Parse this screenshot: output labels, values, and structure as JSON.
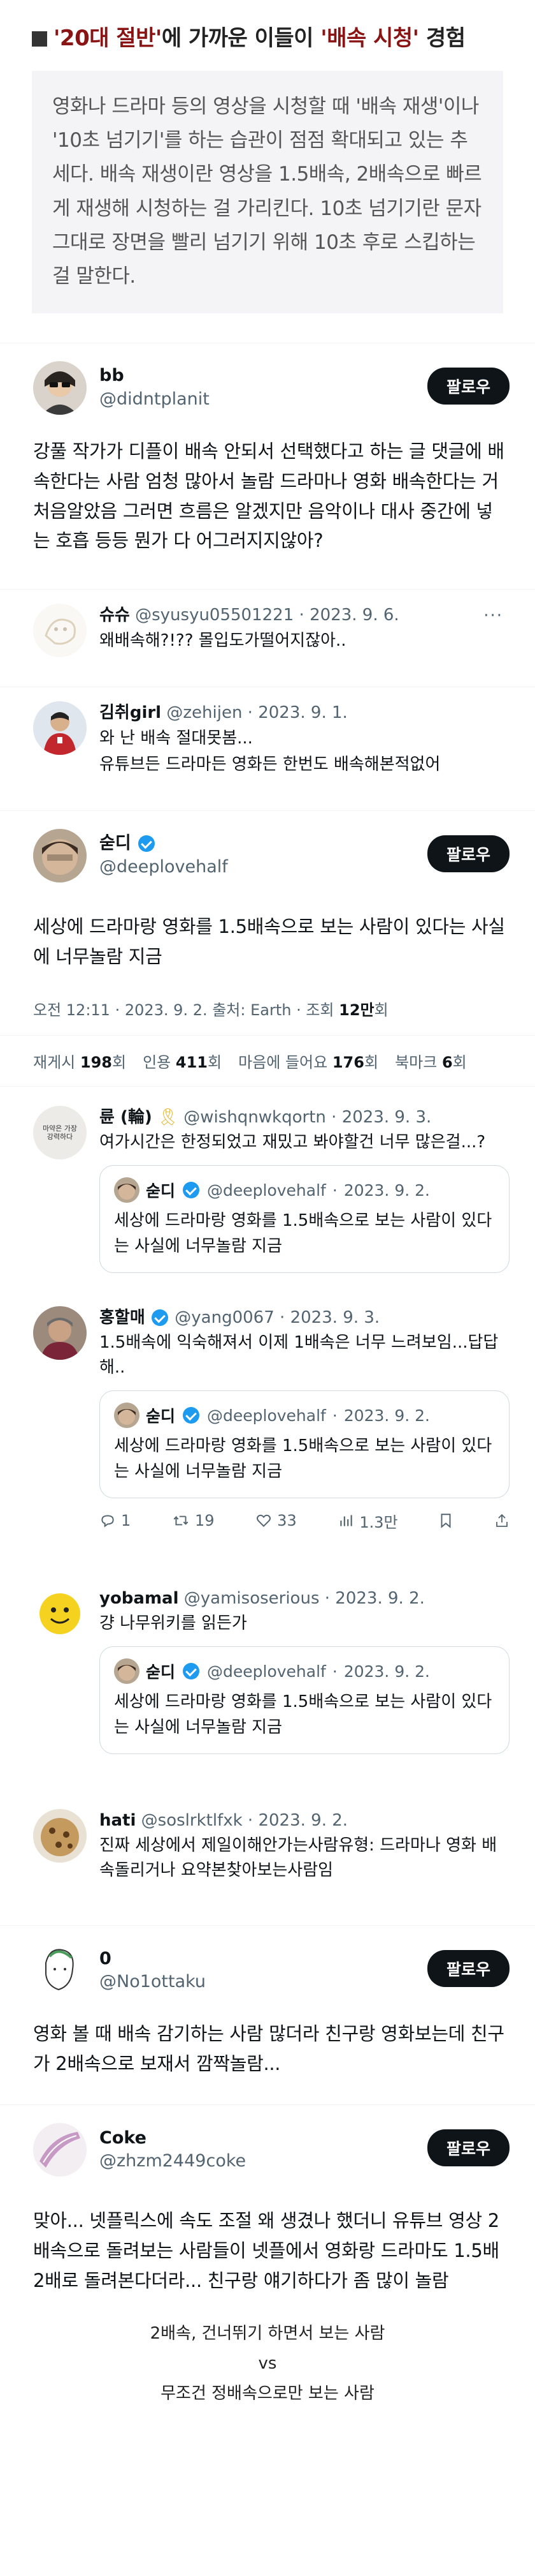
{
  "article": {
    "title_prefix": "■",
    "title_q1": "'20대 절반'",
    "title_mid": "에 가까운 이들이 ",
    "title_q2": "'배속 시청'",
    "title_end": " 경험",
    "body": "영화나 드라마 등의 영상을 시청할 때 '배속 재생'이나 '10초 넘기기'를 하는 습관이 점점 확대되고 있는 추세다. 배속 재생이란 영상을 1.5배속, 2배속으로 빠르게 재생해 시청하는 걸 가리킨다. 10초 넘기기란 문자 그대로 장면을 빨리 넘기기 위해 10초 후로 스킵하는 걸 말한다."
  },
  "follow_label": "팔로우",
  "more_label": "···",
  "tweet1": {
    "name": "bb",
    "handle": "@didntplanit",
    "text": "강풀 작가가 디플이 배속 안되서 선택했다고 하는 글 댓글에 배속한다는 사람 엄청 많아서 놀람 드라마나 영화 배속한다는 거 처음알았음 그러면 흐름은 알겠지만 음악이나 대사 중간에 넣는 호흡 등등 뭔가 다 어그러지지않아?"
  },
  "reply_a": {
    "name": "슈슈",
    "handle": "@syusyu05501221",
    "date": "2023. 9. 6.",
    "text": "왜배속해?!?? 몰입도가떨어지잖아.."
  },
  "reply_b": {
    "name": "김취girl",
    "handle": "@zehijen",
    "date": "2023. 9. 1.",
    "text1": "와 난 배속 절대못봄...",
    "text2": "유튜브든 드라마든 영화든 한번도 배속해본적없어"
  },
  "tweet2": {
    "name": "숟디",
    "handle": "@deeplovehalf",
    "text": "세상에 드라마랑 영화를 1.5배속으로 보는 사람이 있다는 사실에 너무놀람 지금",
    "time": "오전 12:11 · 2023. 9. 2. 출처: Earth · 조회 ",
    "views": "12만",
    "views_unit": "회",
    "retweets_label": "재게시",
    "retweets": "198",
    "quotes_label": "인용",
    "quotes": "411",
    "likes_label": "마음에 들어요",
    "likes": "176",
    "bookmarks_label": "북마크",
    "bookmarks": "6",
    "unit": "회"
  },
  "quoted": {
    "name": "숟디",
    "handle": "@deeplovehalf",
    "date": "2023. 9. 2.",
    "text": "세상에 드라마랑 영화를 1.5배속으로 보는 사람이 있다는 사실에 너무놀람 지금"
  },
  "reply_c": {
    "name": "륜 (輪)",
    "emoji": "🎗",
    "handle": "@wishqnwkqortn",
    "date": "2023. 9. 3.",
    "text": "여가시간은 한정되었고 재밌고 봐야할건 너무 많은걸...?",
    "avatar_text": "마약은 가장 강력하다"
  },
  "reply_d": {
    "name": "홍할매",
    "handle": "@yang0067",
    "date": "2023. 9. 3.",
    "text": "1.5배속에 익숙해져서 이제 1배속은 너무 느려보임...답답해..",
    "replies": "1",
    "retweets": "19",
    "likes": "33",
    "views": "1.3만"
  },
  "reply_e": {
    "name": "yobamal",
    "handle": "@yamisoserious",
    "date": "2023. 9. 2.",
    "text": "걍 나무위키를 읽든가"
  },
  "reply_f": {
    "name": "hati",
    "handle": "@soslrktlfxk",
    "date": "2023. 9. 2.",
    "text": "진짜 세상에서 제일이해안가는사람유형: 드라마나 영화 배속돌리거나 요약본찾아보는사람임"
  },
  "tweet3": {
    "name": "0",
    "handle": "@No1ottaku",
    "text": "영화 볼 때 배속 감기하는 사람 많더라 친구랑 영화보는데 친구가 2배속으로 보재서 깜짝놀람..."
  },
  "tweet4": {
    "name": "Coke",
    "handle": "@zhzm2449coke",
    "text": "맞아... 넷플릭스에 속도 조절 왜 생겼나 했더니 유튜브 영상 2배속으로 돌려보는 사람들이 넷플에서 영화랑 드라마도 1.5배 2배로 돌려본다더라... 친구랑 얘기하다가 좀 많이 놀람"
  },
  "caption": {
    "line1": "2배속, 건너뛰기 하면서 보는 사람",
    "line2": "vs",
    "line3": "무조건 정배속으로만 보는 사람"
  },
  "colors": {
    "accent": "#1d9bf0",
    "dark": "#0f1419",
    "muted": "#536471",
    "title_quote": "#8a1313"
  }
}
